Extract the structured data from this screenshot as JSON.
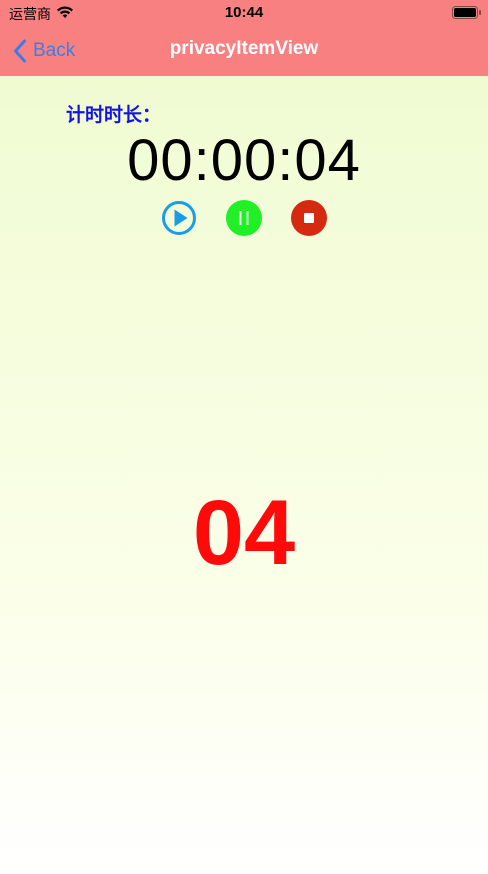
{
  "status_bar": {
    "carrier": "运营商",
    "time": "10:44",
    "wifi_icon": "wifi-icon",
    "battery_icon": "battery-icon"
  },
  "nav": {
    "back_label": "Back",
    "title": "privacyItemView",
    "background_color": "#f88081",
    "back_color": "#3b7de8"
  },
  "timer": {
    "label": "计时时长：",
    "display": "00:00:04",
    "seconds": "04"
  },
  "controls": {
    "play_icon": "play-icon",
    "pause_icon": "pause-icon",
    "stop_icon": "stop-icon",
    "play_color": "#1a9ce8",
    "pause_color": "#22f026",
    "stop_color": "#d42a10"
  },
  "colors": {
    "label_color": "#1414e0",
    "seconds_color": "#ff0a0a"
  }
}
